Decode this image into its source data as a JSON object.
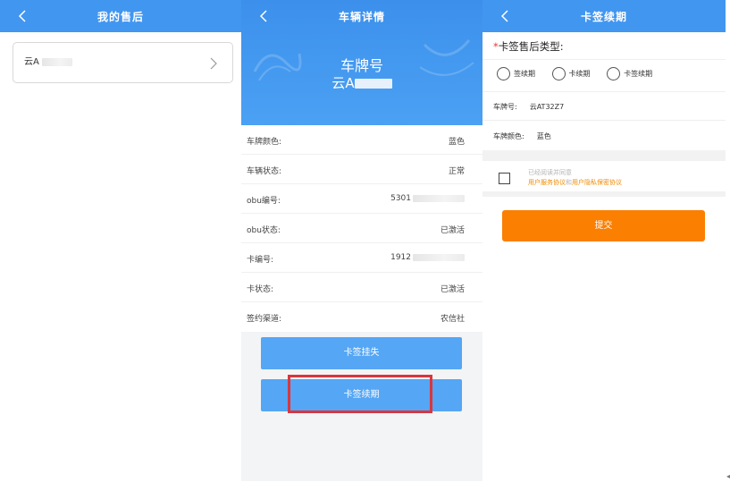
{
  "panel1": {
    "title": "我的售后",
    "plate_prefix": "云A"
  },
  "panel2": {
    "title": "车辆详情",
    "plate_label": "车牌号",
    "plate_prefix": "云A",
    "rows": [
      {
        "label": "车牌颜色:",
        "value": "蓝色"
      },
      {
        "label": "车辆状态:",
        "value": "正常"
      },
      {
        "label": "obu编号:",
        "value": "5301"
      },
      {
        "label": "obu状态:",
        "value": "已激活"
      },
      {
        "label": "卡编号:",
        "value": "1912"
      },
      {
        "label": "卡状态:",
        "value": "已激活"
      },
      {
        "label": "签约渠道:",
        "value": "农信社"
      }
    ],
    "btn_report_loss": "卡签挂失",
    "btn_renew": "卡签续期"
  },
  "panel3": {
    "title": "卡签续期",
    "required_mark": "*",
    "type_label": "卡签售后类型:",
    "options": [
      "签续期",
      "卡续期",
      "卡签续期"
    ],
    "plate_label": "车牌号:",
    "plate_value": "云AT32Z7",
    "color_label": "车牌颜色:",
    "color_value": "蓝色",
    "agree_line1": "已经阅读并同意",
    "agree_service": "用户服务协议",
    "agree_and": "和",
    "agree_privacy": "用户隐私保密协议",
    "submit_label": "提交"
  },
  "colors": {
    "header_blue": "#4196f0",
    "button_blue": "#55a6f4",
    "highlight_red": "#d9363e",
    "submit_orange": "#fb7f00",
    "link_orange": "#f08a00"
  },
  "icons": {
    "back": "chevron-left-icon",
    "arrow": "chevron-right-icon"
  }
}
